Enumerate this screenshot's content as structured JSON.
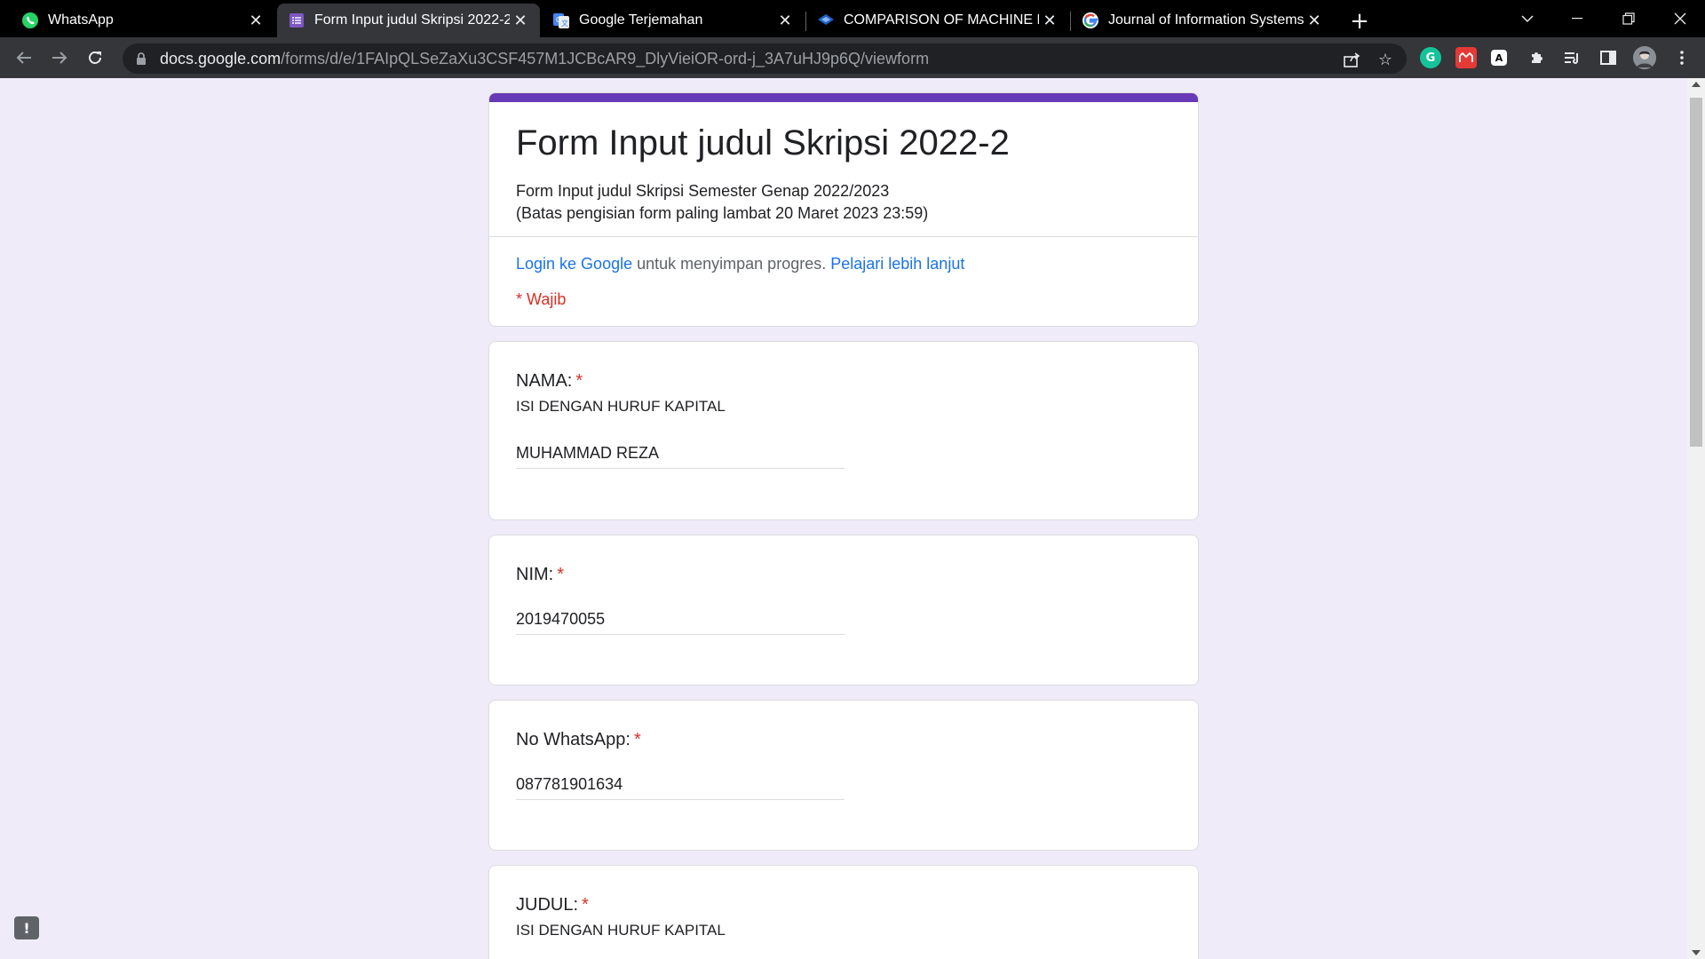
{
  "tabs": [
    {
      "title": "WhatsApp",
      "icon": "whatsapp-icon",
      "active": false
    },
    {
      "title": "Form Input judul Skripsi 2022-2",
      "icon": "google-forms-icon",
      "active": true
    },
    {
      "title": "Google Terjemahan",
      "icon": "google-translate-icon",
      "active": false
    },
    {
      "title": "COMPARISON OF MACHINE LEAR",
      "icon": "journal-icon",
      "active": false
    },
    {
      "title": "Journal of Information Systems E",
      "icon": "google-icon",
      "active": false
    }
  ],
  "address_bar": {
    "host": "docs.google.com",
    "path": "/forms/d/e/1FAIpQLSeZaXu3CSF457M1JCBcAR9_DlyVieiOR-ord-j_3A7uHJ9p6Q/viewform"
  },
  "form": {
    "title": "Form Input judul Skripsi 2022-2",
    "description_line1": "Form Input judul Skripsi Semester Genap 2022/2023",
    "description_line2": "(Batas pengisian form paling lambat 20 Maret 2023 23:59)",
    "login_link": "Login ke Google",
    "login_text": " untuk menyimpan progres. ",
    "learn_more_link": "Pelajari lebih lanjut",
    "required_note": "* Wajib",
    "accent_color": "#673ab7"
  },
  "questions": {
    "nama": {
      "label": "NAMA:",
      "help": "ISI DENGAN HURUF KAPITAL",
      "value": "MUHAMMAD REZA"
    },
    "nim": {
      "label": "NIM:",
      "value": "2019470055"
    },
    "whatsapp": {
      "label": "No WhatsApp:",
      "value": "087781901634"
    },
    "judul": {
      "label": "JUDUL:",
      "help": "ISI DENGAN HURUF KAPITAL"
    }
  },
  "required_marker": "*",
  "feedback_icon": "!"
}
